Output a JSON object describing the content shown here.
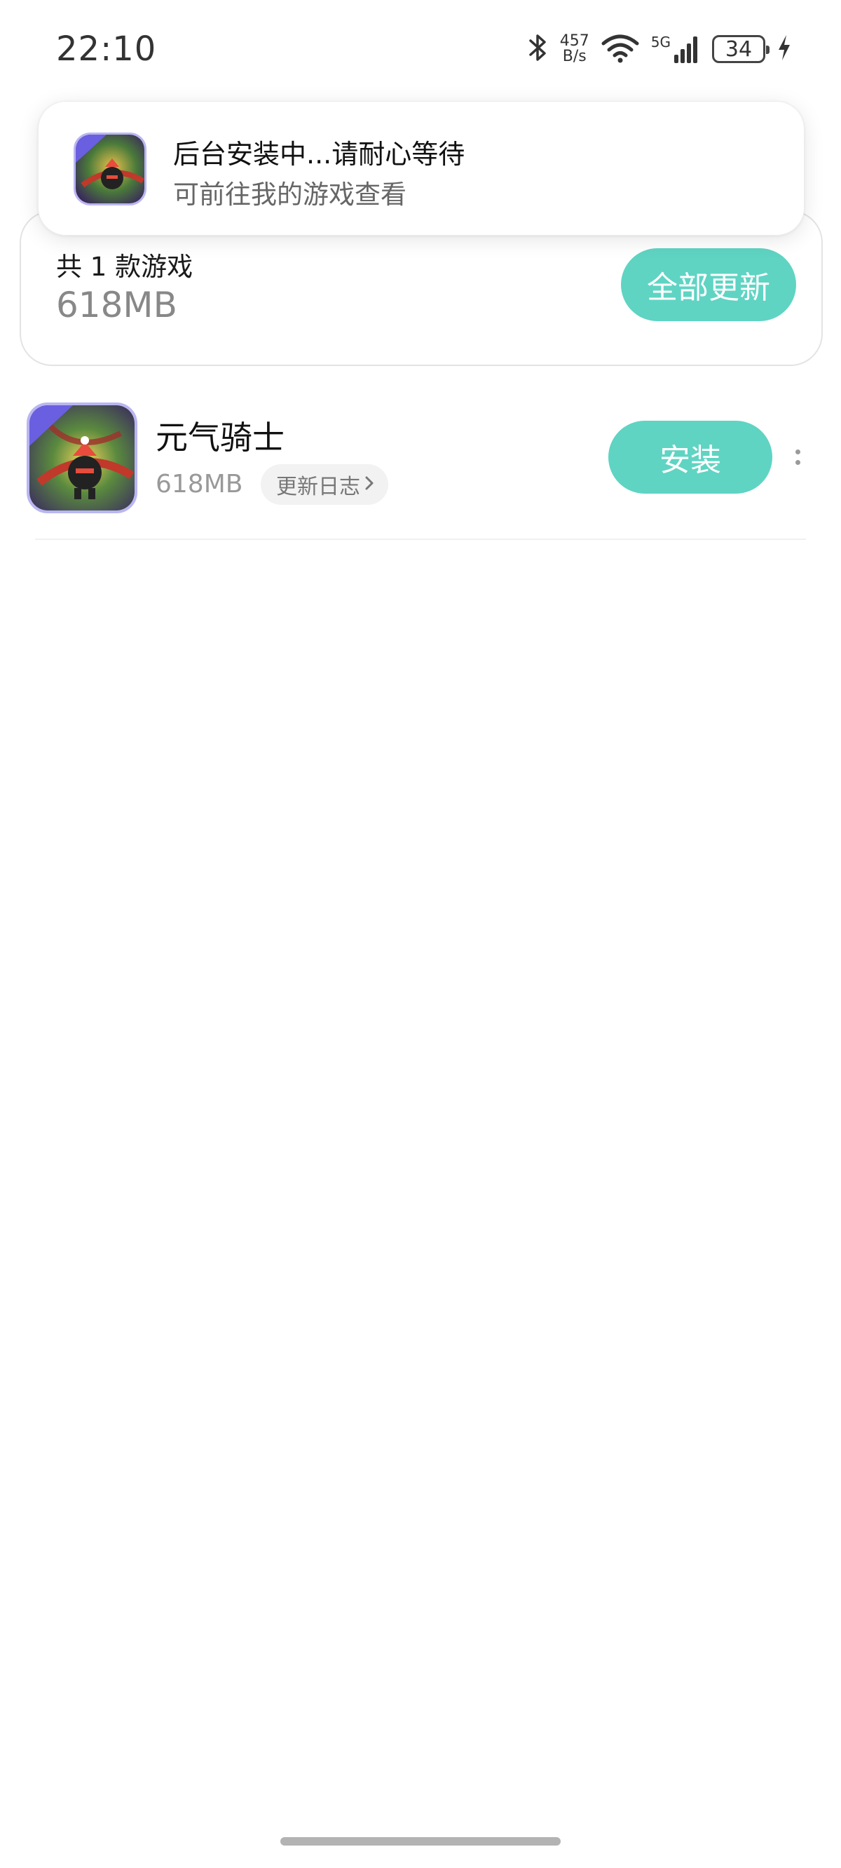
{
  "status_bar": {
    "time": "22:10",
    "net_speed_value": "457",
    "net_speed_unit": "B/s",
    "network": "5G",
    "battery": "34",
    "icons": [
      "bluetooth-icon",
      "wifi-icon",
      "signal-icon",
      "battery-icon",
      "charging-icon"
    ]
  },
  "toast": {
    "title": "后台安装中...请耐心等待",
    "subtitle": "可前往我的游戏查看",
    "icon": "game-icon"
  },
  "summary": {
    "count_label": "共 1 款游戏",
    "total_size": "618MB",
    "update_all_label": "全部更新"
  },
  "games": [
    {
      "name": "元气骑士",
      "size": "618MB",
      "changelog_label": "更新日志",
      "action_label": "安装",
      "icon": "game-icon"
    }
  ],
  "colors": {
    "accent": "#5fd4c3",
    "icon_border": "#b9b6f2",
    "secondary_text": "#999999"
  }
}
